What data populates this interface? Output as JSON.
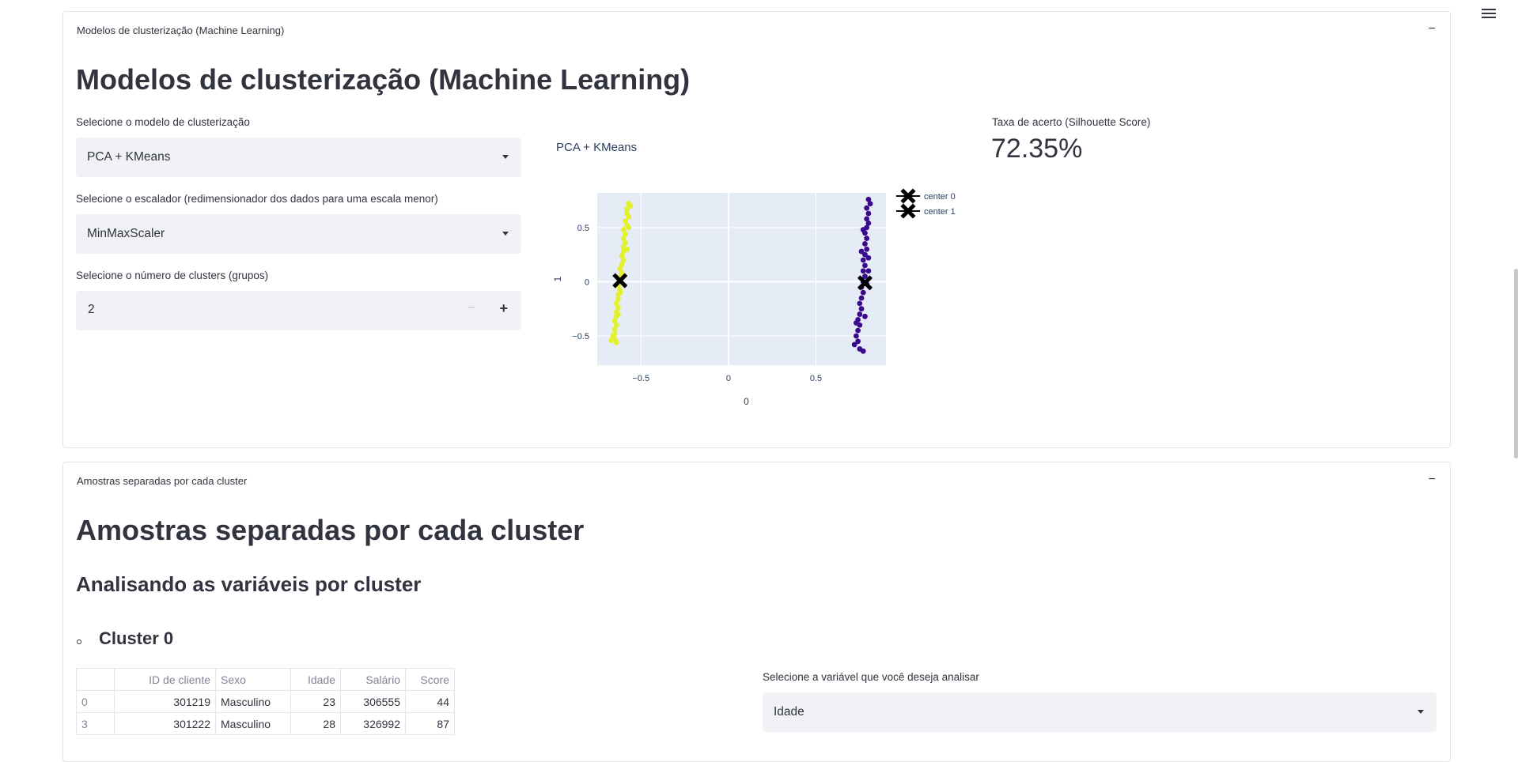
{
  "menu_icon": "hamburger-menu-icon",
  "section1": {
    "expander_label": "Modelos de clusterização (Machine Learning)",
    "toggle": "−",
    "title": "Modelos de clusterização (Machine Learning)",
    "model_select": {
      "label": "Selecione o modelo de clusterização",
      "value": "PCA + KMeans"
    },
    "scaler_select": {
      "label": "Selecione o escalador (redimensionador dos dados para uma escala menor)",
      "value": "MinMaxScaler"
    },
    "clusters_input": {
      "label": "Selecione o número de clusters (grupos)",
      "value": "2",
      "minus": "−",
      "plus": "+"
    },
    "metric": {
      "label": "Taxa de acerto (Silhouette Score)",
      "value": "72.35%"
    },
    "chart_title": "PCA + KMeans"
  },
  "chart_data": {
    "type": "scatter",
    "title": "PCA + KMeans",
    "xlabel": "0",
    "ylabel": "1",
    "xlim": [
      -0.75,
      0.9
    ],
    "ylim": [
      -0.77,
      0.82
    ],
    "xticks": [
      -0.5,
      0,
      0.5
    ],
    "xtick_labels": [
      "−0.5",
      "0",
      "0.5"
    ],
    "yticks": [
      -0.5,
      0,
      0.5
    ],
    "ytick_labels": [
      "−0.5",
      "0",
      "0.5"
    ],
    "grid": true,
    "legend_position": "top-right",
    "series": [
      {
        "color": "#e3f02c",
        "points": [
          [
            -0.57,
            0.72
          ],
          [
            -0.56,
            0.7
          ],
          [
            -0.58,
            0.67
          ],
          [
            -0.58,
            0.63
          ],
          [
            -0.57,
            0.6
          ],
          [
            -0.59,
            0.56
          ],
          [
            -0.58,
            0.52
          ],
          [
            -0.6,
            0.48
          ],
          [
            -0.59,
            0.44
          ],
          [
            -0.6,
            0.4
          ],
          [
            -0.59,
            0.36
          ],
          [
            -0.6,
            0.32
          ],
          [
            -0.6,
            0.28
          ],
          [
            -0.61,
            0.24
          ],
          [
            -0.6,
            0.2
          ],
          [
            -0.61,
            0.16
          ],
          [
            -0.62,
            0.12
          ],
          [
            -0.61,
            0.08
          ],
          [
            -0.62,
            0.04
          ],
          [
            -0.62,
            0.0
          ],
          [
            -0.63,
            -0.04
          ],
          [
            -0.62,
            -0.08
          ],
          [
            -0.63,
            -0.12
          ],
          [
            -0.63,
            -0.16
          ],
          [
            -0.64,
            -0.2
          ],
          [
            -0.63,
            -0.24
          ],
          [
            -0.64,
            -0.28
          ],
          [
            -0.64,
            -0.32
          ],
          [
            -0.65,
            -0.36
          ],
          [
            -0.64,
            -0.4
          ],
          [
            -0.65,
            -0.44
          ],
          [
            -0.65,
            -0.48
          ],
          [
            -0.66,
            -0.5
          ],
          [
            -0.65,
            -0.53
          ],
          [
            -0.64,
            -0.56
          ],
          [
            -0.67,
            -0.54
          ],
          [
            -0.63,
            -0.3
          ],
          [
            -0.62,
            -0.1
          ],
          [
            -0.58,
            0.3
          ],
          [
            -0.57,
            0.5
          ]
        ]
      },
      {
        "color": "#3b0a8c",
        "points": [
          [
            0.8,
            0.76
          ],
          [
            0.81,
            0.72
          ],
          [
            0.79,
            0.68
          ],
          [
            0.8,
            0.63
          ],
          [
            0.79,
            0.58
          ],
          [
            0.8,
            0.54
          ],
          [
            0.79,
            0.5
          ],
          [
            0.78,
            0.45
          ],
          [
            0.79,
            0.4
          ],
          [
            0.78,
            0.35
          ],
          [
            0.79,
            0.3
          ],
          [
            0.78,
            0.25
          ],
          [
            0.77,
            0.2
          ],
          [
            0.78,
            0.15
          ],
          [
            0.77,
            0.1
          ],
          [
            0.78,
            0.05
          ],
          [
            0.77,
            0.0
          ],
          [
            0.76,
            -0.05
          ],
          [
            0.77,
            -0.1
          ],
          [
            0.76,
            -0.15
          ],
          [
            0.75,
            -0.2
          ],
          [
            0.76,
            -0.25
          ],
          [
            0.75,
            -0.3
          ],
          [
            0.74,
            -0.35
          ],
          [
            0.75,
            -0.4
          ],
          [
            0.74,
            -0.45
          ],
          [
            0.73,
            -0.5
          ],
          [
            0.74,
            -0.55
          ],
          [
            0.72,
            -0.58
          ],
          [
            0.75,
            -0.62
          ],
          [
            0.77,
            -0.64
          ],
          [
            0.8,
            0.1
          ],
          [
            0.79,
            -0.02
          ],
          [
            0.76,
            0.28
          ],
          [
            0.78,
            -0.32
          ],
          [
            0.73,
            -0.38
          ],
          [
            0.77,
            0.48
          ],
          [
            0.8,
            0.22
          ]
        ]
      }
    ],
    "centers": [
      {
        "name": "center 0",
        "x": -0.62,
        "y": 0.01,
        "color": "#000000"
      },
      {
        "name": "center 1",
        "x": 0.78,
        "y": -0.01,
        "color": "#000000"
      }
    ]
  },
  "section2": {
    "expander_label": "Amostras separadas por cada cluster",
    "toggle": "−",
    "title": "Amostras separadas por cada cluster",
    "subtitle": "Analisando as variáveis por cluster",
    "cluster_heading": "Cluster 0",
    "table": {
      "columns": [
        "",
        "ID de cliente",
        "Sexo",
        "Idade",
        "Salário",
        "Score"
      ],
      "rows": [
        [
          "0",
          "301219",
          "Masculino",
          "23",
          "306555",
          "44"
        ],
        [
          "3",
          "301222",
          "Masculino",
          "28",
          "326992",
          "87"
        ]
      ]
    },
    "variable_select": {
      "label": "Selecione a variável que você deseja analisar",
      "value": "Idade"
    }
  }
}
